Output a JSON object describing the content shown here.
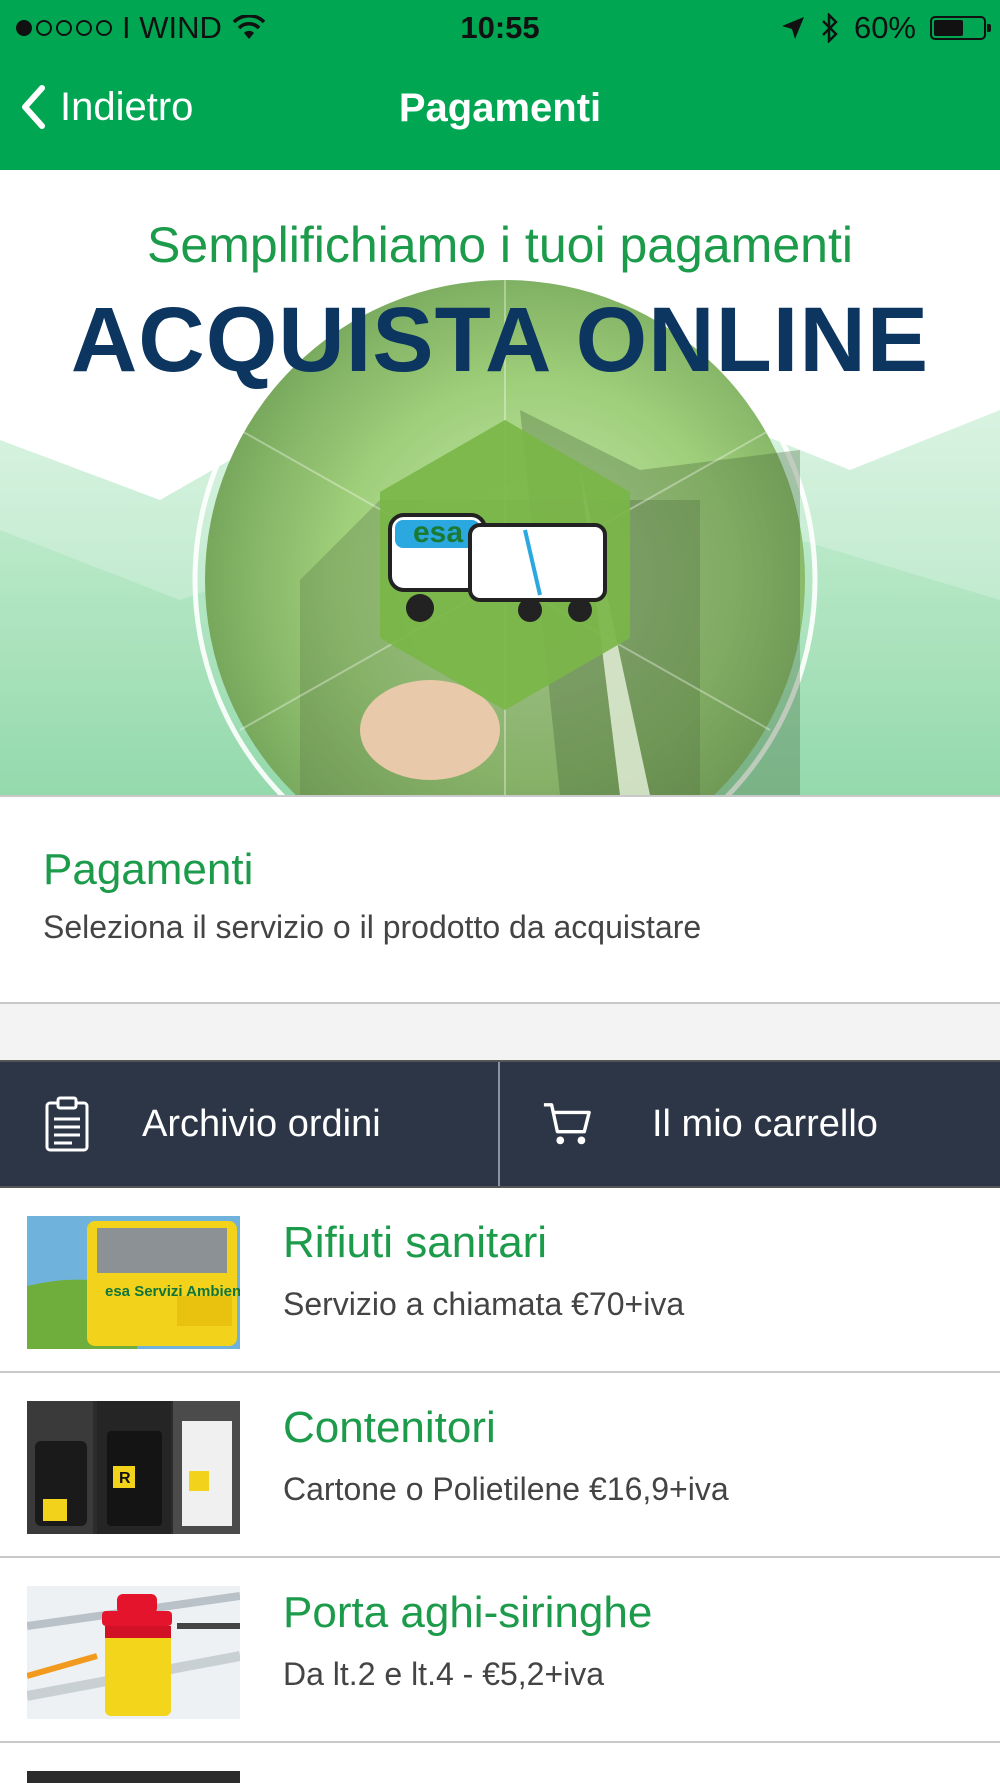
{
  "status_bar": {
    "carrier": "I WIND",
    "time": "10:55",
    "battery": "60%",
    "battery_level": 0.6
  },
  "nav": {
    "back_label": "Indietro",
    "title": "Pagamenti"
  },
  "banner": {
    "tagline": "Semplifichiamo i tuoi pagamenti",
    "headline": "ACQUISTA ONLINE",
    "logo_text": "esa"
  },
  "info": {
    "title": "Pagamenti",
    "subtitle": "Seleziona il servizio o il prodotto da acquistare"
  },
  "actions": {
    "archive_label": "Archivio ordini",
    "cart_label": "Il mio carrello"
  },
  "items": [
    {
      "name": "Rifiuti sanitari",
      "desc": "Servizio a chiamata €70+iva",
      "thumb_text": "esa Servizi Ambientali"
    },
    {
      "name": "Contenitori",
      "desc": "Cartone o Polietilene €16,9+iva",
      "thumb_text": "R"
    },
    {
      "name": "Porta aghi-siringhe",
      "desc": "Da lt.2 e lt.4 - €5,2+iva"
    }
  ],
  "colors": {
    "brand_green": "#00a651",
    "text_green": "#1c9b4b",
    "headline_navy": "#0c3660",
    "action_bar": "#2d3646"
  }
}
